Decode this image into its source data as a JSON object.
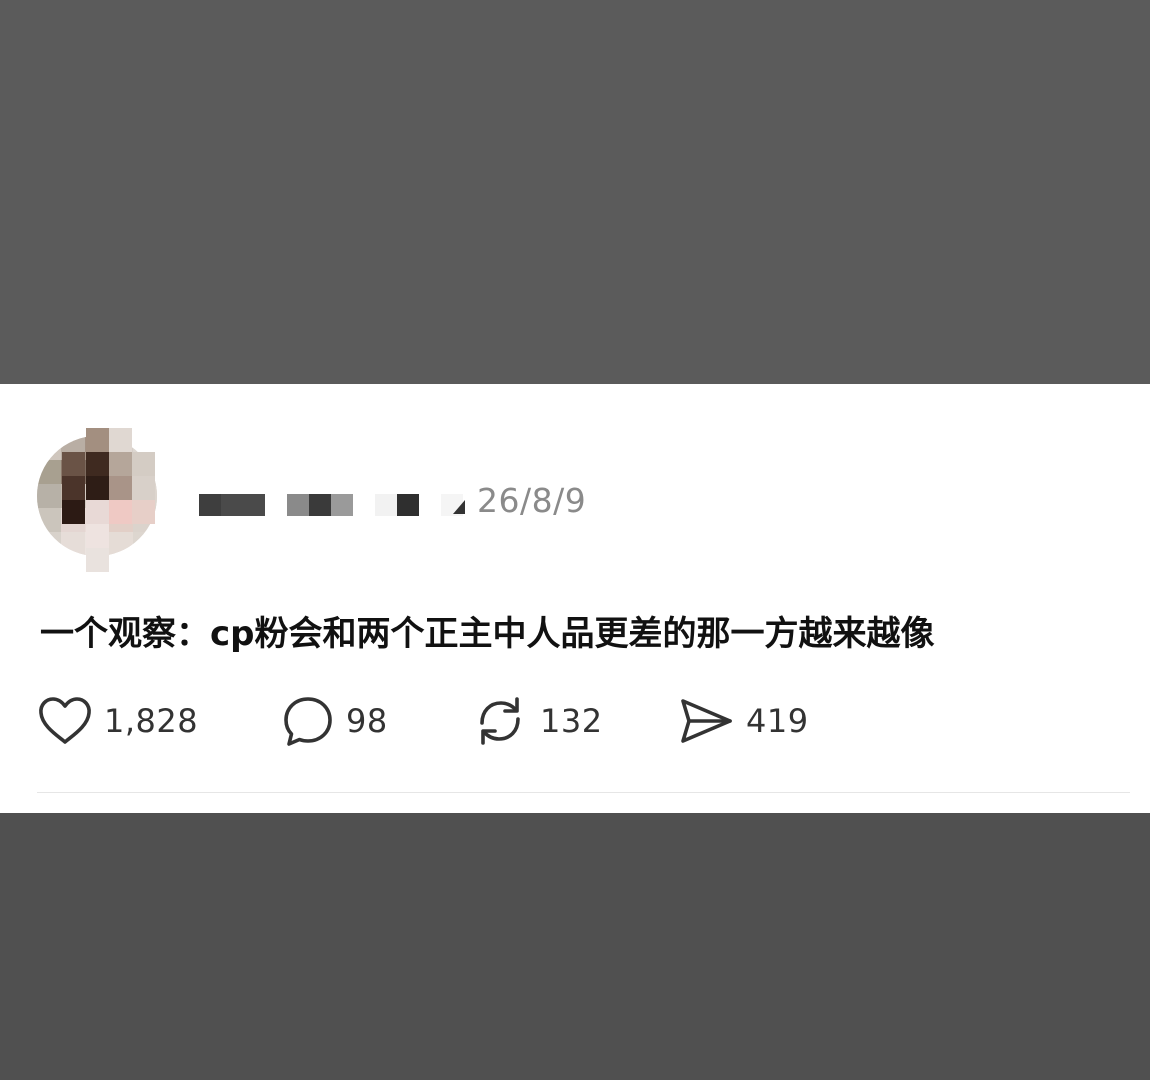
{
  "post": {
    "date": "26/8/9",
    "text": "一个观察：cp粉会和两个正主中人品更差的那一方越来越像"
  },
  "actions": {
    "like": {
      "icon": "heart-icon",
      "count": "1,828"
    },
    "comment": {
      "icon": "comment-bubble-icon",
      "count": "98"
    },
    "repost": {
      "icon": "repost-icon",
      "count": "132"
    },
    "share": {
      "icon": "paper-plane-icon",
      "count": "419"
    }
  },
  "colors": {
    "background_top": "#5b5b5b",
    "background_bottom": "#505050",
    "card": "#ffffff",
    "date_text": "#8a8a8a",
    "body_text": "#111111",
    "icon_stroke": "#333333"
  }
}
